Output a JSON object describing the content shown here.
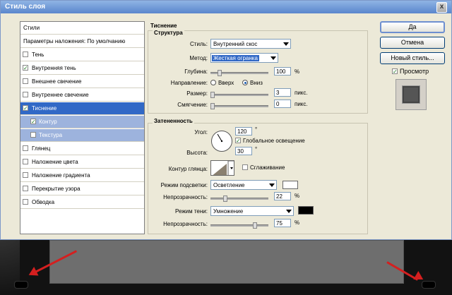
{
  "window": {
    "title": "Стиль слоя",
    "close_glyph": "x"
  },
  "sidebar": {
    "header": "Стили",
    "items": [
      {
        "label": "Параметры наложения: По умолчанию",
        "checked": null,
        "state": "header"
      },
      {
        "label": "Тень",
        "checked": false,
        "state": "normal"
      },
      {
        "label": "Внутренняя тень",
        "checked": true,
        "state": "normal"
      },
      {
        "label": "Внешнее свечение",
        "checked": false,
        "state": "normal"
      },
      {
        "label": "Внутреннее свечение",
        "checked": false,
        "state": "normal"
      },
      {
        "label": "Тиснение",
        "checked": true,
        "state": "active"
      },
      {
        "label": "Контур",
        "checked": true,
        "state": "sub"
      },
      {
        "label": "Текстура",
        "checked": false,
        "state": "sub"
      },
      {
        "label": "Глянец",
        "checked": false,
        "state": "normal"
      },
      {
        "label": "Наложение цвета",
        "checked": false,
        "state": "normal"
      },
      {
        "label": "Наложение градиента",
        "checked": false,
        "state": "normal"
      },
      {
        "label": "Перекрытие узора",
        "checked": false,
        "state": "normal"
      },
      {
        "label": "Обводка",
        "checked": false,
        "state": "normal"
      }
    ]
  },
  "section": {
    "title": "Тиснение"
  },
  "structure": {
    "title": "Структура",
    "style_label": "Стиль:",
    "style_value": "Внутренний скос",
    "method_label": "Метод:",
    "method_value": "Жесткая огранка",
    "depth_label": "Глубина:",
    "depth_value": "100",
    "depth_unit": "%",
    "depth_level": 100,
    "direction_label": "Направление:",
    "direction_up": "Вверх",
    "direction_down": "Вниз",
    "direction_selected": "Вниз",
    "size_label": "Размер:",
    "size_value": "3",
    "size_unit": "пикс.",
    "soften_label": "Смягчение:",
    "soften_value": "0",
    "soften_unit": "пикс."
  },
  "shading": {
    "title": "Затененность",
    "angle_label": "Угол:",
    "angle_value": "120",
    "angle_unit": "°",
    "global_light_label": "Глобальное освещение",
    "global_light_checked": true,
    "altitude_label": "Высота:",
    "altitude_value": "30",
    "altitude_unit": "°",
    "gloss_contour_label": "Контур глянца:",
    "antialias_label": "Сглаживание",
    "antialias_checked": false,
    "highlight_mode_label": "Режим подсветки:",
    "highlight_mode_value": "Осветление",
    "highlight_color": "#ffffff",
    "highlight_opacity_label": "Непрозрачность:",
    "highlight_opacity_value": "22",
    "highlight_opacity_unit": "%",
    "shadow_mode_label": "Режим тени:",
    "shadow_mode_value": "Умножение",
    "shadow_color": "#000000",
    "shadow_opacity_label": "Непрозрачность:",
    "shadow_opacity_value": "75",
    "shadow_opacity_unit": "%"
  },
  "buttons": {
    "ok": "Да",
    "cancel": "Отмена",
    "new_style": "Новый стиль...",
    "preview_label": "Просмотр",
    "preview_checked": true
  },
  "colors": {
    "accent": "#3168c6",
    "title_bar": "#5a86cd",
    "dialog_bg": "#ece9d8",
    "arrow": "#d41f1f"
  }
}
